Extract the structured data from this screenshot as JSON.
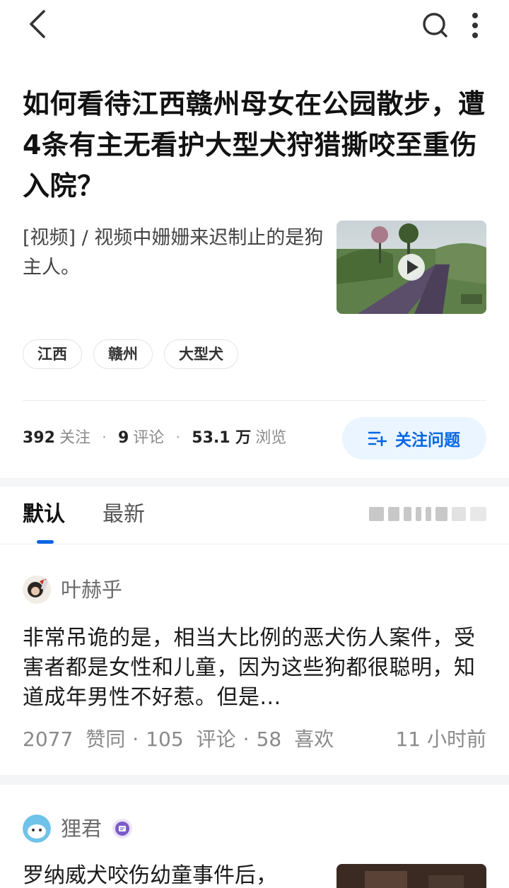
{
  "question": {
    "title": "如何看待江西赣州母女在公园散步，遭4条有主无看护大型犬狩猎撕咬至重伤入院？",
    "excerpt": "[视频] / 视频中姗姗来迟制止的是狗主人。",
    "tags": [
      "江西",
      "赣州",
      "大型犬"
    ],
    "stats": {
      "followers_count": "392",
      "followers_label": "关注",
      "comments_count": "9",
      "comments_label": "评论",
      "views_count": "53.1 万",
      "views_label": "浏览"
    },
    "follow_button_label": "关注问题"
  },
  "tabs": [
    {
      "label": "默认",
      "active": true
    },
    {
      "label": "最新",
      "active": false
    }
  ],
  "answers": [
    {
      "author": "叶赫乎",
      "text": "非常吊诡的是，相当大比例的恶犬伤人案件，受害者都是女性和儿童，因为这些狗都很聪明，知道成年男性不好惹。但是...",
      "upvotes": "2077",
      "upvotes_label": "赞同",
      "comments": "105",
      "comments_label": "评论",
      "likes": "58",
      "likes_label": "喜欢",
      "time": "11 小时前"
    },
    {
      "author": "狸君",
      "text": "罗纳威犬咬伤幼童事件后，"
    }
  ],
  "icons": {
    "back": "chevron-left-icon",
    "search": "search-icon",
    "more": "more-vertical-icon",
    "follow": "add-follow-icon",
    "play": "play-icon",
    "badge": "creator-badge-icon"
  },
  "colors": {
    "accent": "#0566e6",
    "follow_bg": "#ebf5ff",
    "meta_gray": "#8a8a8a",
    "band_gray": "#f4f5f7"
  }
}
